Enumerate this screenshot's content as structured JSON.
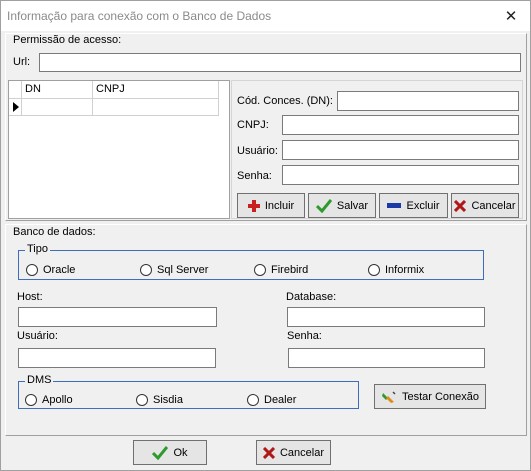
{
  "window": {
    "title": "Informação para conexão com o Banco de Dados",
    "close": "✕"
  },
  "access": {
    "legend": "Permissão de acesso:",
    "url_label": "Url:",
    "url_value": "",
    "grid_columns": [
      "DN",
      "CNPJ"
    ],
    "grid_rows": [
      [
        "",
        ""
      ]
    ],
    "cod_label": "Cód. Conces. (DN):",
    "cnpj_label": "CNPJ:",
    "usuario_label": "Usuário:",
    "senha_label": "Senha:",
    "buttons": {
      "incluir": "Incluir",
      "salvar": "Salvar",
      "excluir": "Excluir",
      "cancelar": "Cancelar"
    }
  },
  "db": {
    "legend": "Banco de dados:",
    "tipo_legend": "Tipo",
    "tipos": [
      "Oracle",
      "Sql Server",
      "Firebird",
      "Informix"
    ],
    "host_label": "Host:",
    "database_label": "Database:",
    "usuario_label": "Usuário:",
    "senha_label": "Senha:",
    "dms_legend": "DMS",
    "dms_options": [
      "Apollo",
      "Sisdia",
      "Dealer"
    ],
    "testar_label": "Testar Conexão"
  },
  "footer": {
    "ok_label": "Ok",
    "cancel_label": "Cancelar"
  },
  "colors": {
    "accent_border": "#3c6fb8",
    "incluir_icon": "#c82020",
    "salvar_icon": "#2e9a2e",
    "excluir_icon": "#1a3aa8",
    "cancelar_icon": "#b01818"
  }
}
